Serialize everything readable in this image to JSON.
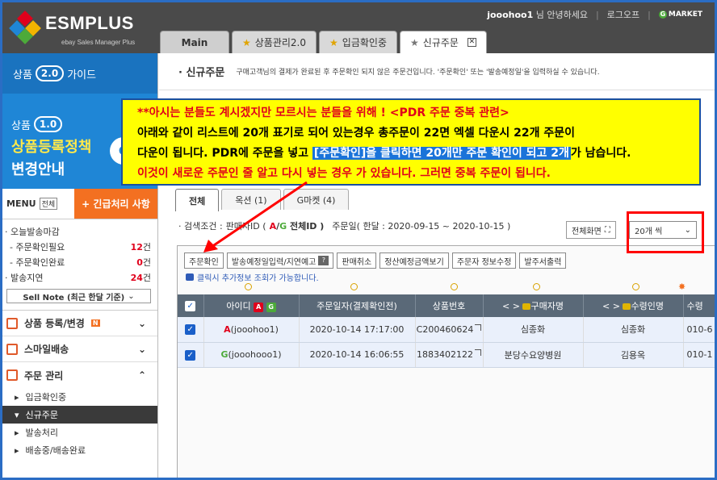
{
  "app": {
    "logo_name": "ESMPLUS",
    "logo_sub": "ebay Sales Manager Plus"
  },
  "userbar": {
    "user": "jooohoo1",
    "greeting": "님 안녕하세요",
    "logout": "로그오프",
    "gmarket": "MARKET"
  },
  "tabs": [
    {
      "label": "Main"
    },
    {
      "label": "상품관리2.0"
    },
    {
      "label": "입금확인중"
    },
    {
      "label": "신규주문"
    }
  ],
  "sidebar": {
    "guide_prefix": "상품",
    "guide_badge": "2.0",
    "guide_suffix": "가이드",
    "policy_prefix": "상품",
    "policy_badge": "1.0",
    "policy_line1": "상품등록정책",
    "policy_line2": "변경안내",
    "policy_circle": "G",
    "menu_label": "MENU",
    "menu_all": "전체",
    "urgent_label": "긴급처리 사항",
    "summary": [
      {
        "label": "· 오늘발송마감",
        "count": "",
        "unit": ""
      },
      {
        "label": "  - 주문확인필요",
        "count": "12",
        "unit": "건"
      },
      {
        "label": "  - 주문확인완료",
        "count": "0",
        "unit": "건"
      },
      {
        "label": "· 발송지연",
        "count": "24",
        "unit": "건"
      }
    ],
    "sell_note": "Sell Note (최근 한달 기준)",
    "sections": [
      {
        "label": "상품 등록/변경",
        "new": "N"
      },
      {
        "label": "스마일배송"
      },
      {
        "label": "주문 관리"
      }
    ],
    "subitems": [
      "입금확인중",
      "신규주문",
      "발송처리",
      "배송중/배송완료"
    ]
  },
  "content": {
    "title": "신규주문",
    "description": "구매고객님의 결제가 완료된 후 주문확인 되지 않은 주문건입니다. '주문확인' 또는 '발송예정일'을 입력하실 수 있습니다.",
    "subtabs": [
      "전체",
      "옥션 (1)",
      "G마켓 (4)"
    ],
    "search_label": "· 검색조건 :",
    "search_field": "판매자ID (",
    "search_a": "A",
    "search_slash": "/",
    "search_g": "G",
    "search_all": " 전체ID )",
    "date_label": "주문일( 한달 : 2020-09-15 ~ 2020-10-15 )",
    "expand_label": "전체화면",
    "perpage_value": "20개 씩",
    "buttons": [
      "주문확인",
      "발송예정일입력/지연예고",
      "판매취소",
      "정산예정금액보기",
      "주문자 정보수정",
      "발주서출력"
    ],
    "hint": "클릭시 추가정보 조회가 가능합니다.",
    "columns": [
      "아이디",
      "주문일자(결제확인전)",
      "상품번호",
      "구매자명",
      "수령인명",
      "수령"
    ],
    "rows": [
      {
        "site": "A",
        "id": "(jooohoo1)",
        "date": "2020-10-14 17:17:00",
        "product": "C200460624",
        "buyer": "심종화",
        "receiver": "심종화",
        "phone": "010-6"
      },
      {
        "site": "G",
        "id": "(jooohooo1)",
        "date": "2020-10-14 16:06:55",
        "product": "1883402122",
        "buyer": "분당수요양병원",
        "receiver": "김용옥",
        "phone": "010-1"
      }
    ]
  },
  "note": {
    "line1": "**아시는 분들도 계시겠지만  모르시는 분들을  위해 ! <PDR 주문 중복 관련>",
    "line2": "아래와 같이 리스트에 20개 표기로 되어 있는경우  총주문이 22면  엑셀 다운시 22개 주문이",
    "line3_pre": "다운이 됩니다. PDR에 주문을 넣고 ",
    "line3_hl": "[주문확인]을 클릭하면 20개만 주문 확인이 되고 2개",
    "line3_post": "가 남습니다.",
    "line4": "이것이 새로운 주문인 줄  알고  다시       넣는 경우 가 있습니다. 그러면 중복 주문이 됩니다."
  },
  "colors": {
    "accent": "#1f86d6",
    "urgent": "#f37021",
    "note_bg": "#ffff00",
    "highlight": "#ff0000"
  }
}
